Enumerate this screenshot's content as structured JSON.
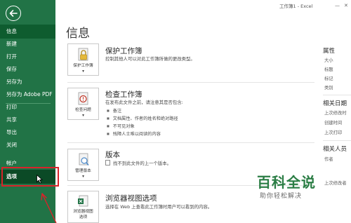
{
  "window": {
    "title": "工作簿1 - Excel"
  },
  "sidebar": {
    "items": [
      {
        "label": "信息"
      },
      {
        "label": "新建"
      },
      {
        "label": "打开"
      },
      {
        "label": "保存"
      },
      {
        "label": "另存为"
      },
      {
        "label": "另存为 Adobe PDF"
      },
      {
        "label": "打印"
      },
      {
        "label": "共享"
      },
      {
        "label": "导出"
      },
      {
        "label": "关闭"
      },
      {
        "label": "帐户"
      },
      {
        "label": "选项"
      }
    ]
  },
  "main": {
    "title": "信息",
    "sections": [
      {
        "button_label": [
          "保护工作簿",
          "▾"
        ],
        "title": "保护工作簿",
        "desc": "控制其他人可以对此工作簿所做的更改类型。"
      },
      {
        "button_label": [
          "检查问题",
          "▾"
        ],
        "title": "检查工作簿",
        "desc": "在发布此文件之前，请注意其是否包含:",
        "bullets": [
          "备注",
          "文档属性、作者的姓名和绝对路径",
          "不可见对象",
          "残障人士难以阅读的内容"
        ]
      },
      {
        "button_label": [
          "管理版本",
          "▾"
        ],
        "title": "版本",
        "desc": "找不到此文件的上一个版本。"
      },
      {
        "button_label": [
          "浏览器视图",
          "选项"
        ],
        "title": "浏览器视图选项",
        "desc": "选择在 Web 上查看此工作簿时用户可以看到的内容。"
      }
    ]
  },
  "properties": {
    "heading": "属性",
    "items": [
      "大小",
      "标题",
      "标记",
      "类别"
    ],
    "dates_heading": "相关日期",
    "dates": [
      "上次修改时",
      "创建时间",
      "上次打印"
    ],
    "people_heading": "相关人员",
    "people": [
      "作者",
      "上次修改者"
    ]
  },
  "watermark": {
    "name": "百科全说",
    "tagline": "助你轻松解决"
  },
  "colors": {
    "sidebar": "#217346",
    "selected": "#0e5c2f",
    "highlight": "#d9232a"
  }
}
